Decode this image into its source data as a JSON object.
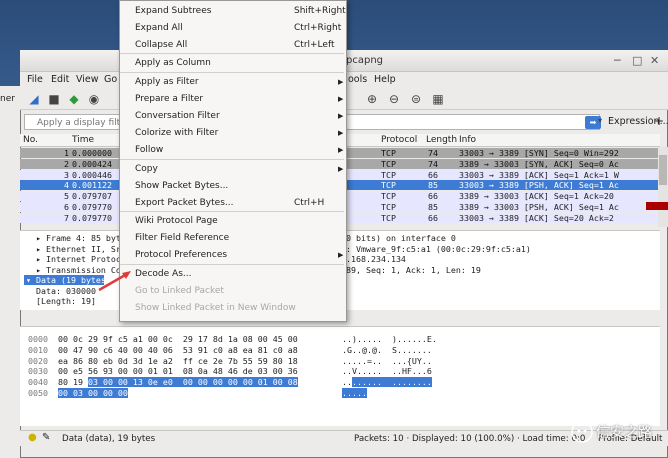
{
  "window": {
    "title_fragment": "pcapng"
  },
  "background_window": {
    "text_fragment": "ner"
  },
  "menubar": [
    "File",
    "Edit",
    "View",
    "Go",
    "ools",
    "Help"
  ],
  "filter": {
    "placeholder": "Apply a display filter",
    "expression_label": "Expression..."
  },
  "packet_list": {
    "headers": {
      "no": "No.",
      "time": "Time",
      "protocol": "Protocol",
      "length": "Length",
      "info": "Info"
    },
    "rows": [
      {
        "no": "1",
        "time": "0.000000",
        "protocol": "TCP",
        "length": "74",
        "info": "33003 → 3389 [SYN] Seq=0 Win=292",
        "style": "gray"
      },
      {
        "no": "2",
        "time": "0.000424",
        "protocol": "TCP",
        "length": "74",
        "info": "3389 → 33003 [SYN, ACK] Seq=0 Ac",
        "style": "gray"
      },
      {
        "no": "3",
        "time": "0.000446",
        "protocol": "TCP",
        "length": "66",
        "info": "33003 → 3389 [ACK] Seq=1 Ack=1 W",
        "style": "lav"
      },
      {
        "no": "4",
        "time": "0.001122",
        "protocol": "TCP",
        "length": "85",
        "info": "33003 → 3389 [PSH, ACK] Seq=1 Ac",
        "style": "sel"
      },
      {
        "no": "5",
        "time": "0.079707",
        "protocol": "TCP",
        "length": "66",
        "info": "3389 → 33003 [ACK] Seq=1 Ack=20",
        "style": "lav"
      },
      {
        "no": "6",
        "time": "0.079770",
        "protocol": "TCP",
        "length": "85",
        "info": "3389 → 33003 [PSH, ACK] Seq=1 Ac",
        "style": "lav"
      },
      {
        "no": "7",
        "time": "0.079770",
        "protocol": "TCP",
        "length": "66",
        "info": "33003 → 3389 [ACK] Seq=20 Ack=2",
        "style": "lav"
      }
    ]
  },
  "details": [
    {
      "text": "▸ Frame 4: 85 byt",
      "tail": "680 bits) on interface 0"
    },
    {
      "text": "▸ Ethernet II, Sr",
      "tail": "st: Vmware_9f:c5:a1 (00:0c:29:9f:c5:a1)"
    },
    {
      "text": "▸ Internet Protoc",
      "tail": "92.168.234.134"
    },
    {
      "text": "▸ Transmission Co",
      "tail": "3389, Seq: 1, Ack: 1, Len: 19"
    },
    {
      "text": "▾ Data (19 bytes)",
      "tail": ""
    },
    {
      "text": "    Data: 030000",
      "tail": ""
    },
    {
      "text": "    [Length: 19]",
      "tail": ""
    }
  ],
  "hex": [
    {
      "offset": "0000",
      "bytes": "00 0c 29 9f c5 a1 00 0c  29 17 8d 1a 08 00 45 00",
      "ascii": "..).....  )......E."
    },
    {
      "offset": "0010",
      "bytes": "00 47 90 c6 40 00 40 06  53 91 c0 a8 ea 81 c0 a8",
      "ascii": ".G..@.@.  S......."
    },
    {
      "offset": "0020",
      "bytes": "ea 86 80 eb 0d 3d 1e a2  ff ce 2e 7b 55 59 80 18",
      "ascii": ".....=..  ...{UY.."
    },
    {
      "offset": "0030",
      "bytes": "00 e5 56 93 00 00 01 01  08 0a 48 46 de 03 00 36",
      "ascii": "..V.....  ..HF...6"
    },
    {
      "offset": "0040",
      "bytes_plain": "80 19 ",
      "bytes_hl": "03 00 00 13 0e e0  00 00 00 00 00 01 00 08",
      "ascii_plain": "..",
      "ascii_hl": "......  ........"
    },
    {
      "offset": "0050",
      "bytes_plain": "",
      "bytes_hl": "00 03 00 00 00",
      "ascii_plain": "",
      "ascii_hl": "....."
    }
  ],
  "status": {
    "left": "Data (data), 19 bytes",
    "packets": "Packets: 10 · Displayed: 10 (100.0%) · Load time: 0:0",
    "profile": "Profile: Default"
  },
  "context_menu": [
    {
      "label": "Expand Subtrees",
      "shortcut": "Shift+Right"
    },
    {
      "label": "Expand All",
      "shortcut": "Ctrl+Right"
    },
    {
      "label": "Collapse All",
      "shortcut": "Ctrl+Left"
    },
    {
      "label": "Apply as Column",
      "shortcut": ""
    },
    {
      "label": "Apply as Filter",
      "submenu": true
    },
    {
      "label": "Prepare a Filter",
      "submenu": true
    },
    {
      "label": "Conversation Filter",
      "submenu": true
    },
    {
      "label": "Colorize with Filter",
      "submenu": true
    },
    {
      "label": "Follow",
      "submenu": true
    },
    {
      "label": "Copy",
      "submenu": true
    },
    {
      "label": "Show Packet Bytes...",
      "shortcut": ""
    },
    {
      "label": "Export Packet Bytes...",
      "shortcut": "Ctrl+H"
    },
    {
      "label": "Wiki Protocol Page",
      "shortcut": ""
    },
    {
      "label": "Filter Field Reference",
      "shortcut": ""
    },
    {
      "label": "Protocol Preferences",
      "submenu": true
    },
    {
      "label": "Decode As...",
      "shortcut": ""
    },
    {
      "label": "Go to Linked Packet",
      "disabled": true
    },
    {
      "label": "Show Linked Packet in New Window",
      "disabled": true
    }
  ],
  "watermark": {
    "text": "信安之路"
  },
  "colors": {
    "selected_row": "#3d7bd4",
    "gray_row": "#a8a8a8",
    "lavender_row": "#e7e6ff",
    "red_arrow": "#e03a3a"
  }
}
